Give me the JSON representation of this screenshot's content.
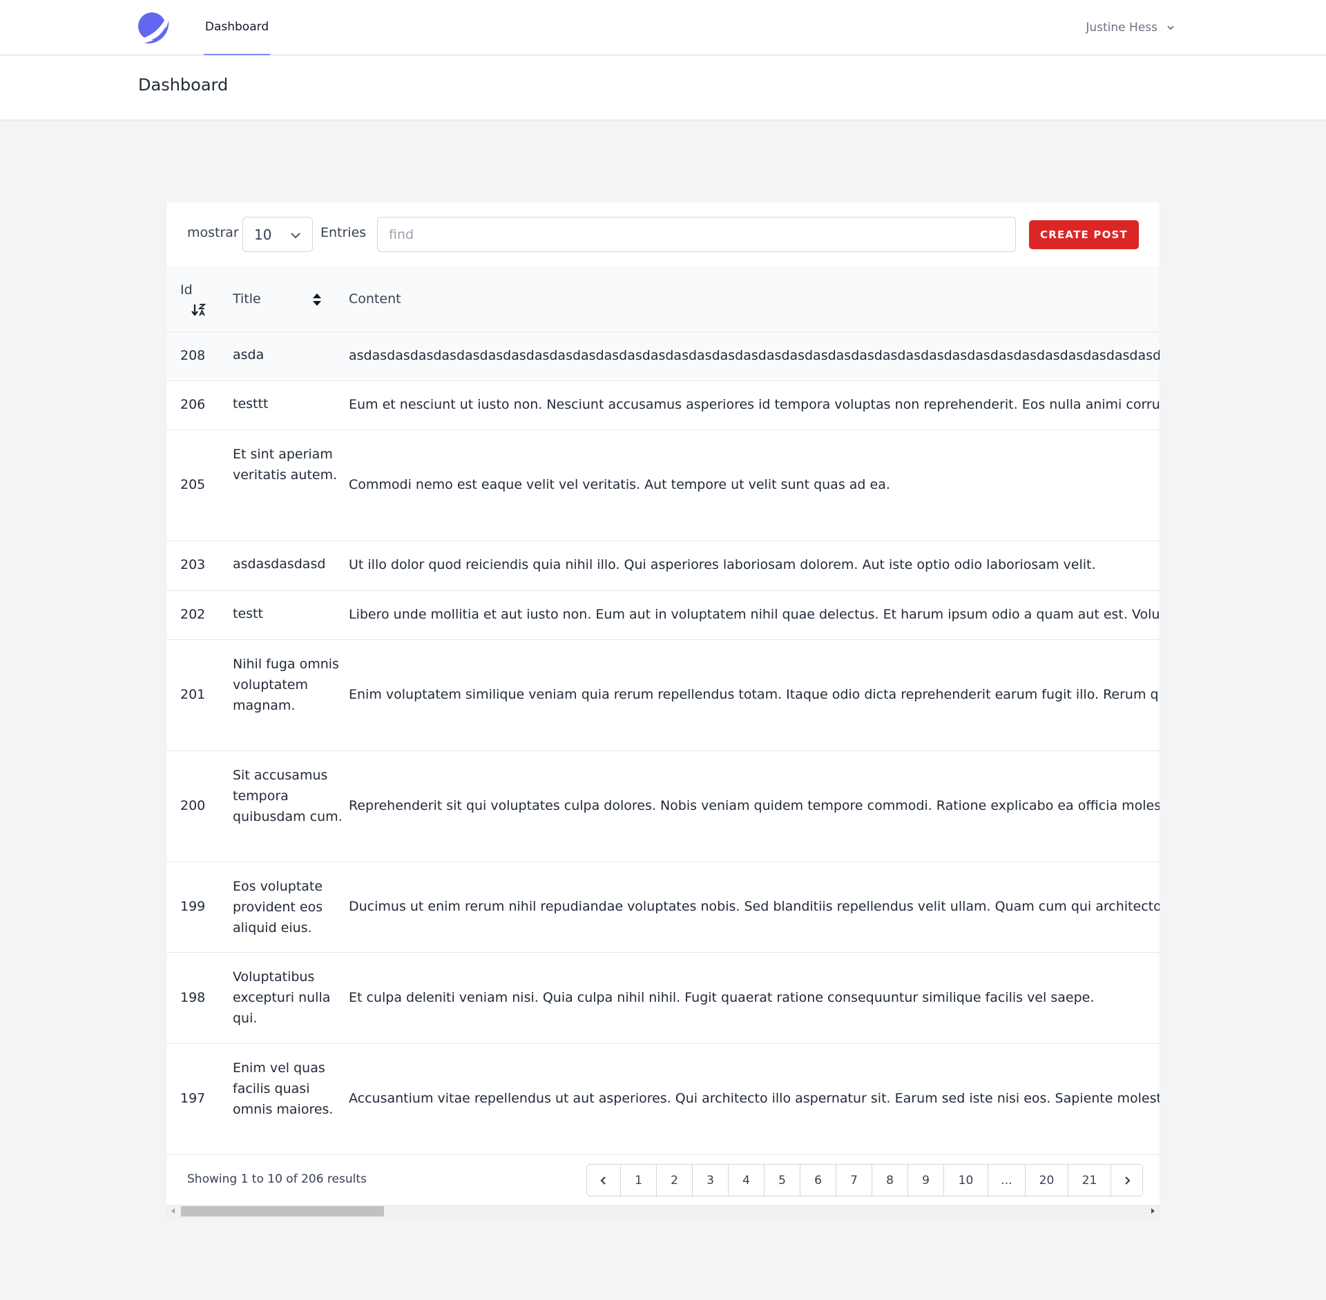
{
  "nav": {
    "dashboard_link": "Dashboard",
    "user_name": "Justine Hess"
  },
  "header": {
    "title": "Dashboard"
  },
  "toolbar": {
    "show_label": "mostrar",
    "page_size": "10",
    "entries_label": "Entries",
    "search_placeholder": "find",
    "create_button": "CREATE POST"
  },
  "table": {
    "columns": {
      "id": "Id",
      "title": "Title",
      "content": "Content"
    },
    "rows": [
      {
        "id": "208",
        "title": "asda",
        "content": "asdasdasdasdasdasdasdasdasdasdasdasdasdasdasdasdasdasdasdasdasdasdasdasdasdasdasdasdasdasdasdasdasdasdasd"
      },
      {
        "id": "206",
        "title": "testtt",
        "content": "Eum et nesciunt ut iusto non. Nesciunt accusamus asperiores id tempora voluptas non reprehenderit. Eos nulla animi corrupti."
      },
      {
        "id": "205",
        "title": "Et sint aperiam veritatis autem.",
        "content": "Commodi nemo est eaque velit vel veritatis. Aut tempore ut velit sunt quas ad ea."
      },
      {
        "id": "203",
        "title": "asdasdasdasd",
        "content": "Ut illo dolor quod reiciendis quia nihil illo. Qui asperiores laboriosam dolorem. Aut iste optio odio laboriosam velit."
      },
      {
        "id": "202",
        "title": "testt",
        "content": "Libero unde mollitia et aut iusto non. Eum aut in voluptatem nihil quae delectus. Et harum ipsum odio a quam aut est. Voluptas saep"
      },
      {
        "id": "201",
        "title": "Nihil fuga omnis voluptatem magnam.",
        "content": "Enim voluptatem similique veniam quia rerum repellendus totam. Itaque odio dicta reprehenderit earum fugit illo. Rerum quo exercit"
      },
      {
        "id": "200",
        "title": "Sit accusamus tempora quibusdam cum.",
        "content": "Reprehenderit sit qui voluptates culpa dolores. Nobis veniam quidem tempore commodi. Ratione explicabo ea officia molestiae est."
      },
      {
        "id": "199",
        "title": "Eos voluptate provident eos aliquid eius.",
        "content": "Ducimus ut enim rerum nihil repudiandae voluptates nobis. Sed blanditiis repellendus velit ullam. Quam cum qui architecto qui exce"
      },
      {
        "id": "198",
        "title": "Voluptatibus excepturi nulla qui.",
        "content": "Et culpa deleniti veniam nisi. Quia culpa nihil nihil. Fugit quaerat ratione consequuntur similique facilis vel saepe."
      },
      {
        "id": "197",
        "title": "Enim vel quas facilis quasi omnis maiores.",
        "content": "Accusantium vitae repellendus ut aut asperiores. Qui architecto illo aspernatur sit. Earum sed iste nisi eos. Sapiente molestiae ea ea"
      }
    ]
  },
  "footer": {
    "showing_text": "Showing 1 to 10 of 206 results",
    "pages": [
      "1",
      "2",
      "3",
      "4",
      "5",
      "6",
      "7",
      "8",
      "9",
      "10",
      "...",
      "20",
      "21"
    ]
  },
  "colors": {
    "accent": "#818cf8",
    "logo": "#6366f1",
    "create_button": "#dc2626"
  }
}
